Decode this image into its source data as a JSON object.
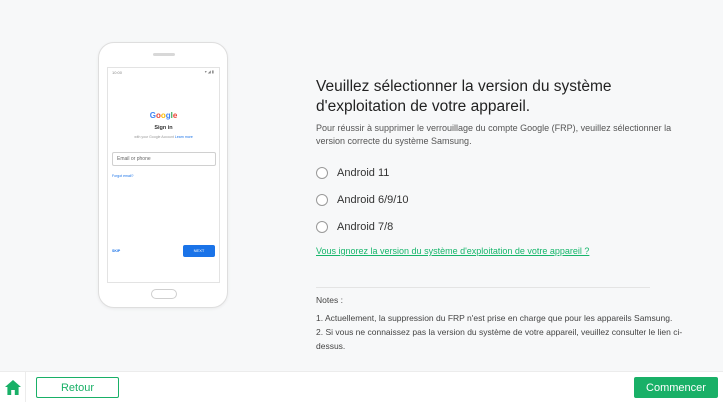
{
  "colors": {
    "accent": "#19b067",
    "link": "#16b66b",
    "google_blue": "#1a73e8"
  },
  "phone": {
    "status_time": "10:00",
    "status_icons": "▾◢▮",
    "google_letters": [
      "G",
      "o",
      "o",
      "g",
      "l",
      "e"
    ],
    "sign_in": "Sign in",
    "subtitle": "with your Google Account",
    "subtitle_link": "Learn more",
    "input_placeholder": "Email or phone",
    "forgot": "Forgot email?",
    "create": "SKIP",
    "next": "NEXT"
  },
  "main": {
    "title": "Veuillez sélectionner la version du système d'exploitation de votre appareil.",
    "description": "Pour réussir à supprimer le verrouillage du compte Google (FRP), veuillez sélectionner la version correcte du système Samsung.",
    "options": [
      "Android 11",
      "Android 6/9/10",
      "Android 7/8"
    ],
    "link": "Vous ignorez la version du système d'exploitation de votre appareil ?",
    "notes_title": "Notes :",
    "note_1": "1. Actuellement, la suppression du FRP n'est prise en charge que pour les appareils Samsung.",
    "note_2": "2. Si vous ne connaissez pas la version du système de votre appareil, veuillez consulter le lien ci-dessus."
  },
  "footer": {
    "home_icon": "home-icon",
    "back_label": "Retour",
    "start_label": "Commencer"
  }
}
